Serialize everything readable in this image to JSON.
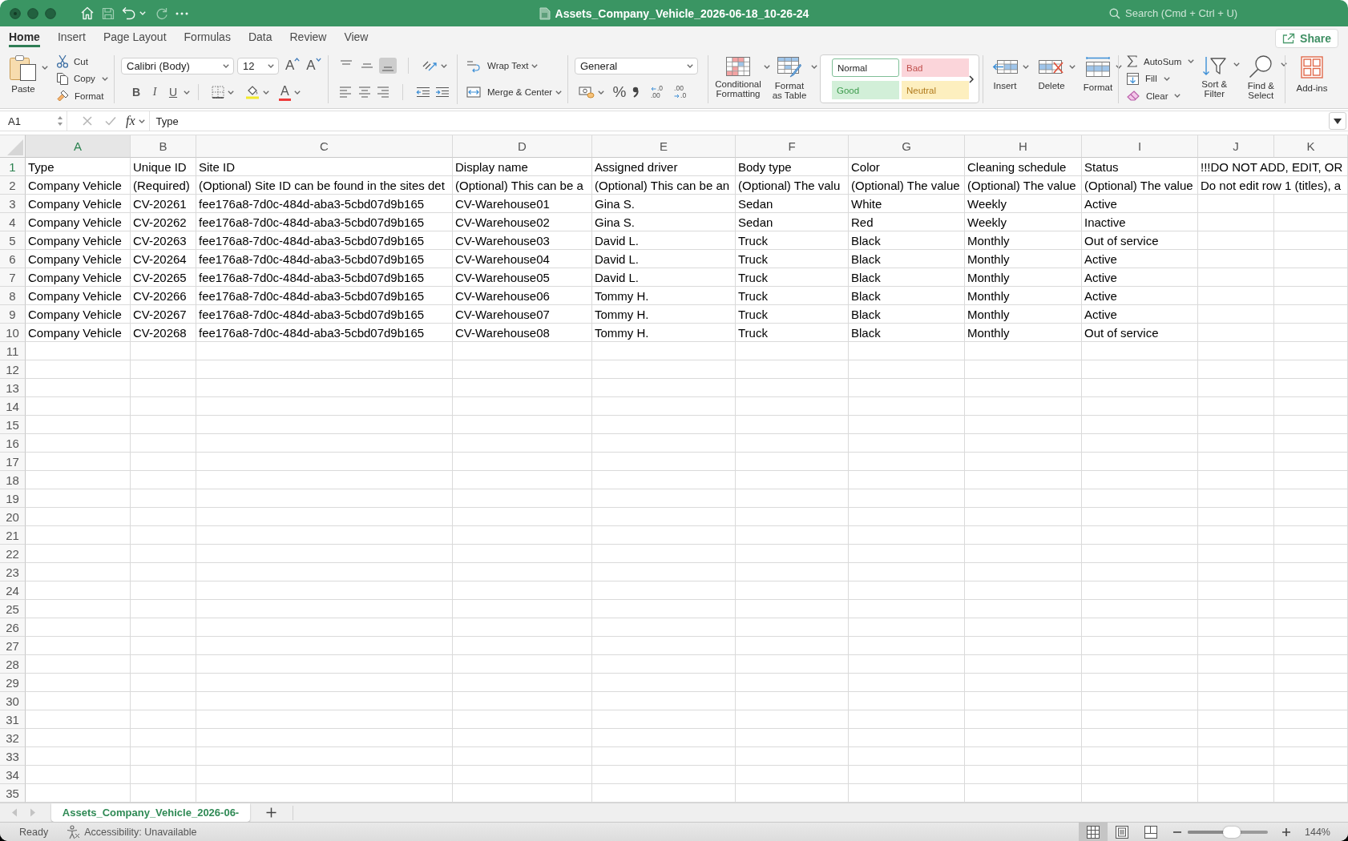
{
  "window": {
    "title": "Assets_Company_Vehicle_2026-06-18_10-26-24",
    "search": {
      "placeholder": "Search (Cmd + Ctrl + U)"
    }
  },
  "ribbon_tabs": [
    {
      "label": "Home",
      "selected": true
    },
    {
      "label": "Insert",
      "selected": false
    },
    {
      "label": "Page Layout",
      "selected": false
    },
    {
      "label": "Formulas",
      "selected": false
    },
    {
      "label": "Data",
      "selected": false
    },
    {
      "label": "Review",
      "selected": false
    },
    {
      "label": "View",
      "selected": false
    }
  ],
  "share_button": {
    "label": "Share"
  },
  "clipboard": {
    "paste": "Paste",
    "items": [
      {
        "kind": "cut",
        "label": "Cut"
      },
      {
        "kind": "copy",
        "label": "Copy"
      },
      {
        "kind": "format_painter",
        "label": "Format"
      }
    ]
  },
  "font": {
    "family": "Calibri (Body)",
    "size": "12",
    "size_buttons": [
      {
        "kind": "grow",
        "label": "A"
      },
      {
        "kind": "shrink",
        "label": "A"
      }
    ],
    "style_buttons": [
      {
        "kind": "bold",
        "label": "B"
      },
      {
        "kind": "italic",
        "label": "I"
      },
      {
        "kind": "underline",
        "label": "U"
      }
    ],
    "font_color_label": "A"
  },
  "alignment": {
    "align_buttons": [
      {
        "kind": "top",
        "selected": false
      },
      {
        "kind": "middle",
        "selected": false
      },
      {
        "kind": "bottom",
        "selected": true
      },
      {
        "kind": "left",
        "selected": false
      },
      {
        "kind": "center",
        "selected": false
      },
      {
        "kind": "right",
        "selected": false
      }
    ],
    "wrap_text": "Wrap Text",
    "merge": "Merge & Center"
  },
  "number": {
    "format": "General",
    "percent": "%",
    "decimals": [
      {
        "kind": "increase",
        "top": ".0",
        "bottom": ".00"
      },
      {
        "kind": "decrease",
        "top": ".00",
        "bottom": ".0"
      }
    ]
  },
  "styles": {
    "conditional_formatting": "Conditional Formatting",
    "format_as_table": "Format as Table",
    "cell_styles": [
      {
        "kind": "normal",
        "label": "Normal",
        "selected": true
      },
      {
        "kind": "bad",
        "label": "Bad",
        "selected": false
      },
      {
        "kind": "good",
        "label": "Good",
        "selected": false
      },
      {
        "kind": "neutral",
        "label": "Neutral",
        "selected": false
      }
    ]
  },
  "cells": [
    {
      "kind": "insert",
      "label": "Insert"
    },
    {
      "kind": "delete",
      "label": "Delete"
    },
    {
      "kind": "format",
      "label": "Format"
    }
  ],
  "editing": {
    "autosum": "AutoSum",
    "fill": "Fill",
    "clear": "Clear",
    "sort_filter": "Sort & Filter",
    "find_select": "Find & Select"
  },
  "add_ins": "Add-ins",
  "formula_bar": {
    "name_box": "A1",
    "function_label": "fx",
    "formula": "Type"
  },
  "sheet": {
    "columns": [
      {
        "label": "A",
        "selected": true
      },
      {
        "label": "B",
        "selected": false
      },
      {
        "label": "C",
        "selected": false
      },
      {
        "label": "D",
        "selected": false
      },
      {
        "label": "E",
        "selected": false
      },
      {
        "label": "F",
        "selected": false
      },
      {
        "label": "G",
        "selected": false
      },
      {
        "label": "H",
        "selected": false
      },
      {
        "label": "I",
        "selected": false
      },
      {
        "label": "J",
        "selected": false
      },
      {
        "label": "K",
        "selected": false
      }
    ],
    "rows": [
      {
        "number": "1",
        "selected": true,
        "cells": [
          "Type",
          "Unique ID",
          "Site ID",
          "Display name",
          "Assigned driver",
          "Body type",
          "Color",
          "Cleaning schedule",
          "Status",
          "!!!DO NOT ADD, EDIT, OR"
        ]
      },
      {
        "number": "2",
        "selected": false,
        "cells": [
          "Company Vehicle",
          "(Required)",
          "(Optional) Site ID can be found in the sites det",
          "(Optional) This can be a",
          "(Optional) This can be an",
          "(Optional) The valu",
          "(Optional) The value",
          "(Optional) The value",
          "(Optional) The value",
          "Do not edit row 1 (titles), a"
        ]
      },
      {
        "number": "3",
        "selected": false,
        "cells": [
          "Company Vehicle",
          "CV-20261",
          "fee176a8-7d0c-484d-aba3-5cbd07d9b165",
          "CV-Warehouse01",
          "Gina S.",
          "Sedan",
          "White",
          "Weekly",
          "Active"
        ]
      },
      {
        "number": "4",
        "selected": false,
        "cells": [
          "Company Vehicle",
          "CV-20262",
          "fee176a8-7d0c-484d-aba3-5cbd07d9b165",
          "CV-Warehouse02",
          "Gina S.",
          "Sedan",
          "Red",
          "Weekly",
          "Inactive"
        ]
      },
      {
        "number": "5",
        "selected": false,
        "cells": [
          "Company Vehicle",
          "CV-20263",
          "fee176a8-7d0c-484d-aba3-5cbd07d9b165",
          "CV-Warehouse03",
          "David L.",
          "Truck",
          "Black",
          "Monthly",
          "Out of service"
        ]
      },
      {
        "number": "6",
        "selected": false,
        "cells": [
          "Company Vehicle",
          "CV-20264",
          "fee176a8-7d0c-484d-aba3-5cbd07d9b165",
          "CV-Warehouse04",
          "David L.",
          "Truck",
          "Black",
          "Monthly",
          "Active"
        ]
      },
      {
        "number": "7",
        "selected": false,
        "cells": [
          "Company Vehicle",
          "CV-20265",
          "fee176a8-7d0c-484d-aba3-5cbd07d9b165",
          "CV-Warehouse05",
          "David L.",
          "Truck",
          "Black",
          "Monthly",
          "Active"
        ]
      },
      {
        "number": "8",
        "selected": false,
        "cells": [
          "Company Vehicle",
          "CV-20266",
          "fee176a8-7d0c-484d-aba3-5cbd07d9b165",
          "CV-Warehouse06",
          "Tommy H.",
          "Truck",
          "Black",
          "Monthly",
          "Active"
        ]
      },
      {
        "number": "9",
        "selected": false,
        "cells": [
          "Company Vehicle",
          "CV-20267",
          "fee176a8-7d0c-484d-aba3-5cbd07d9b165",
          "CV-Warehouse07",
          "Tommy H.",
          "Truck",
          "Black",
          "Monthly",
          "Active"
        ]
      },
      {
        "number": "10",
        "selected": false,
        "cells": [
          "Company Vehicle",
          "CV-20268",
          "fee176a8-7d0c-484d-aba3-5cbd07d9b165",
          "CV-Warehouse08",
          "Tommy H.",
          "Truck",
          "Black",
          "Monthly",
          "Out of service"
        ]
      },
      {
        "number": "11",
        "selected": false
      },
      {
        "number": "12",
        "selected": false
      },
      {
        "number": "13",
        "selected": false
      },
      {
        "number": "14",
        "selected": false
      },
      {
        "number": "15",
        "selected": false
      },
      {
        "number": "16",
        "selected": false
      },
      {
        "number": "17",
        "selected": false
      },
      {
        "number": "18",
        "selected": false
      },
      {
        "number": "19",
        "selected": false
      },
      {
        "number": "20",
        "selected": false
      },
      {
        "number": "21",
        "selected": false
      },
      {
        "number": "22",
        "selected": false
      },
      {
        "number": "23",
        "selected": false
      },
      {
        "number": "24",
        "selected": false
      },
      {
        "number": "25",
        "selected": false
      },
      {
        "number": "26",
        "selected": false
      },
      {
        "number": "27",
        "selected": false
      },
      {
        "number": "28",
        "selected": false
      },
      {
        "number": "29",
        "selected": false
      },
      {
        "number": "30",
        "selected": false
      },
      {
        "number": "31",
        "selected": false
      },
      {
        "number": "32",
        "selected": false
      },
      {
        "number": "33",
        "selected": false
      },
      {
        "number": "34",
        "selected": false
      },
      {
        "number": "35",
        "selected": false
      }
    ]
  },
  "sheet_tabs": [
    {
      "label": "Assets_Company_Vehicle_2026-06-",
      "selected": true
    }
  ],
  "status_bar": {
    "status": "Ready",
    "accessibility": "Accessibility: Unavailable",
    "views": [
      {
        "kind": "normal",
        "selected": true
      },
      {
        "kind": "page_layout",
        "selected": false
      },
      {
        "kind": "page_break",
        "selected": false
      }
    ],
    "zoom": {
      "level": 0.55,
      "label": "144%"
    }
  }
}
